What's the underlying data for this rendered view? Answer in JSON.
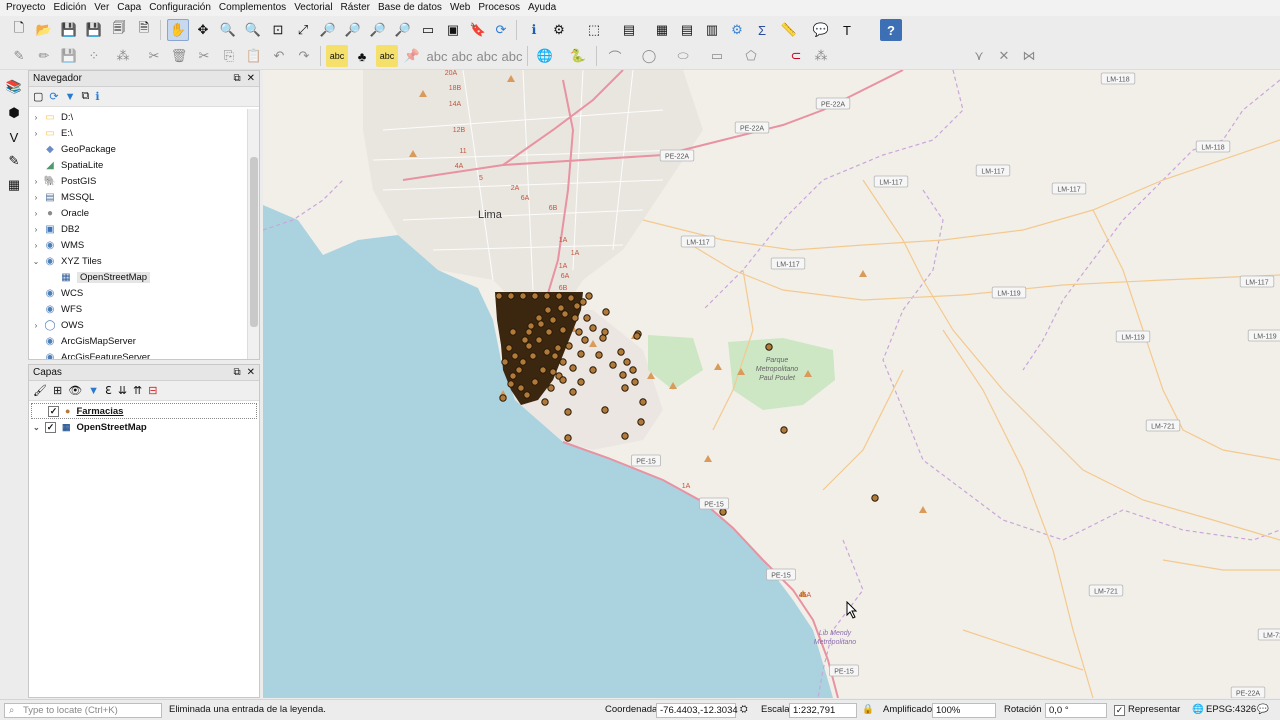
{
  "menu": [
    "Proyecto",
    "Edición",
    "Ver",
    "Capa",
    "Configuración",
    "Complementos",
    "Vectorial",
    "Ráster",
    "Base de datos",
    "Web",
    "Procesos",
    "Ayuda"
  ],
  "toolbar2": {
    "font_size_value": "12",
    "unit_value": "px"
  },
  "navigator": {
    "title": "Navegador",
    "items": [
      {
        "label": "D:\\",
        "icon": "folder-icon",
        "expandable": true
      },
      {
        "label": "E:\\",
        "icon": "folder-icon",
        "expandable": true
      },
      {
        "label": "GeoPackage",
        "icon": "geopackage-icon",
        "expandable": false
      },
      {
        "label": "SpatiaLite",
        "icon": "spatialite-icon",
        "expandable": false
      },
      {
        "label": "PostGIS",
        "icon": "postgis-icon",
        "expandable": true
      },
      {
        "label": "MSSQL",
        "icon": "mssql-icon",
        "expandable": true
      },
      {
        "label": "Oracle",
        "icon": "oracle-icon",
        "expandable": true
      },
      {
        "label": "DB2",
        "icon": "db2-icon",
        "expandable": true
      },
      {
        "label": "WMS",
        "icon": "wms-icon",
        "expandable": true
      },
      {
        "label": "XYZ Tiles",
        "icon": "xyz-tiles-icon",
        "expandable": true,
        "expanded": true
      },
      {
        "label": "OpenStreetMap",
        "icon": "tile-layer-icon",
        "child": true,
        "selected": true
      },
      {
        "label": "WCS",
        "icon": "wcs-icon",
        "expandable": false
      },
      {
        "label": "WFS",
        "icon": "wfs-icon",
        "expandable": false
      },
      {
        "label": "OWS",
        "icon": "ows-icon",
        "expandable": true
      },
      {
        "label": "ArcGisMapServer",
        "icon": "arcgis-icon",
        "expandable": false
      },
      {
        "label": "ArcGisFeatureServer",
        "icon": "arcgis-icon",
        "expandable": false
      }
    ]
  },
  "layers": {
    "title": "Capas",
    "items": [
      {
        "label": "Farmacias",
        "checked": true,
        "icon": "point-layer-icon"
      },
      {
        "label": "OpenStreetMap",
        "checked": true,
        "icon": "tile-layer-icon",
        "expandable": true
      }
    ]
  },
  "map": {
    "labels": {
      "city": "Lima",
      "park": "Parque Metropolitano Paul Poulet",
      "coastal": "Lib Mendy Metropolitano"
    },
    "road_shields": [
      "PE-22A",
      "PE-22A",
      "PE-22A",
      "LM-118",
      "LM-118",
      "LM-117",
      "LM-117",
      "LM-117",
      "LM-117",
      "LM-117",
      "LM-119",
      "LM-119",
      "LM-117",
      "LM-119",
      "LM-721",
      "LM-721",
      "LM-721",
      "PE-15",
      "PE-15",
      "PE-15",
      "PE-15",
      "PE-22A"
    ],
    "route_labels": [
      "20A",
      "18B",
      "14A",
      "12B",
      "11",
      "4A",
      "5",
      "2A",
      "6A",
      "6B",
      "1A",
      "1A",
      "1A",
      "6A",
      "6B",
      "1A",
      "45A"
    ],
    "colors": {
      "water": "#aad3df",
      "land": "#f2efe9",
      "point": "#b07a3a",
      "point_outline": "#2b1a08",
      "primary_road": "#e892a2",
      "trunk": "#f9b29c",
      "boundary": "#c9a6d9",
      "park": "#cde6c4"
    }
  },
  "status": {
    "locate_placeholder": "Type to locate (Ctrl+K)",
    "message": "Eliminada una entrada de la leyenda.",
    "coord_label": "Coordenada",
    "coord_value": "-76.4403,-12.3034",
    "scale_label": "Escala",
    "scale_value": "1:232,791",
    "magnifier_label": "Amplificador",
    "magnifier_value": "100%",
    "rotation_label": "Rotación",
    "rotation_value": "0,0 °",
    "render_label": "Representar",
    "crs_label": "EPSG:4326"
  }
}
